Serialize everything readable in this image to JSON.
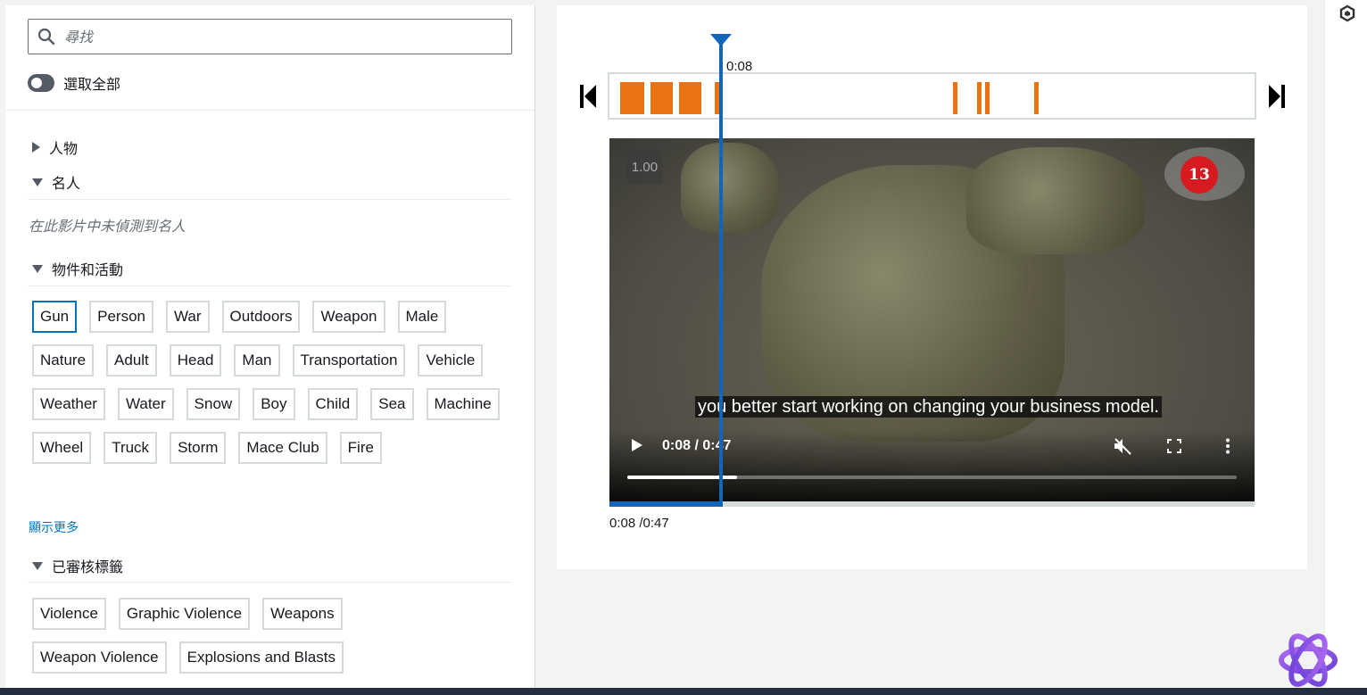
{
  "search": {
    "placeholder": "尋找"
  },
  "select_all": {
    "label": "選取全部",
    "checked": false
  },
  "sections": {
    "people": "人物",
    "celebrities": "名人",
    "celebrities_empty": "在此影片中未偵測到名人",
    "objects": "物件和活動",
    "moderation": "已審核標籤"
  },
  "object_tags": [
    "Gun",
    "Person",
    "War",
    "Outdoors",
    "Weapon",
    "Male",
    "Nature",
    "Adult",
    "Head",
    "Man",
    "Transportation",
    "Vehicle",
    "Weather",
    "Water",
    "Snow",
    "Boy",
    "Child",
    "Sea",
    "Machine",
    "Wheel",
    "Truck",
    "Storm",
    "Mace Club",
    "Fire"
  ],
  "selected_tag": "Gun",
  "show_more": "顯示更多",
  "moderation_tags": [
    "Violence",
    "Graphic Violence",
    "Weapons",
    "Weapon Violence",
    "Explosions and Blasts"
  ],
  "timeline": {
    "playhead_time": "0:08",
    "current_fraction": 0.17
  },
  "video": {
    "speed": "1.00",
    "channel_logo": "13",
    "subtitle": "you better start working on changing your business model.",
    "time": "0:08 / 0:47",
    "progress_fraction": 0.18
  },
  "time_readout": "0:08 /0:47",
  "icons": [
    "search-icon",
    "skip-back-icon",
    "skip-forward-icon",
    "play-icon",
    "mute-icon",
    "fullscreen-icon",
    "more-vert-icon",
    "extension-icon",
    "chatgpt-icon"
  ],
  "colors": {
    "accent": "#0073bb",
    "segment": "#ec7211",
    "playhead": "#1166bb"
  }
}
